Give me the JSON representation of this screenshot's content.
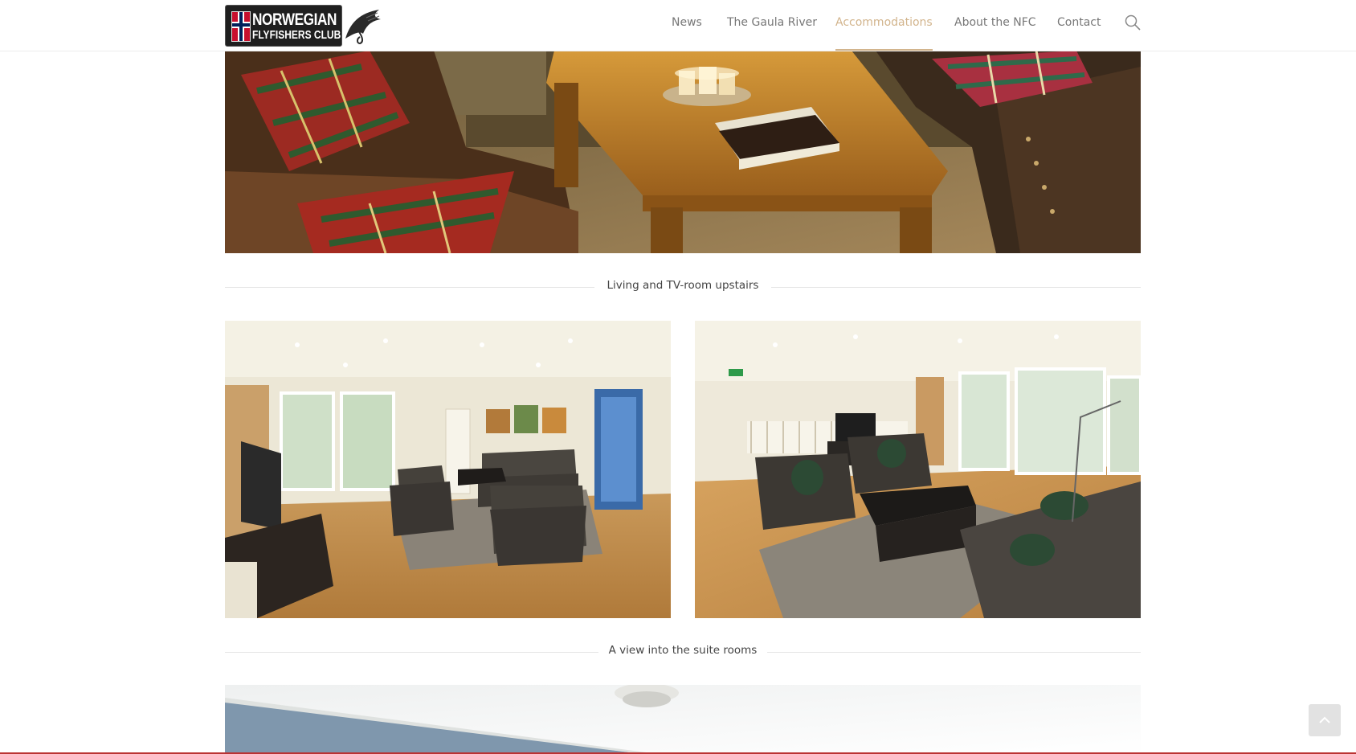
{
  "header": {
    "logo": {
      "line1": "NORWEGIAN",
      "line2": "FLYFISHERS CLUB"
    },
    "nav": [
      {
        "label": "News"
      },
      {
        "label": "The Gaula River"
      },
      {
        "label": "Accommodations",
        "active": true
      },
      {
        "label": "About the NFC"
      },
      {
        "label": "Contact"
      }
    ],
    "search_icon": "search-icon",
    "accent_color": "#d2b48c"
  },
  "gallery": {
    "captions": [
      "Living and TV-room upstairs",
      "A view into the suite rooms"
    ]
  },
  "scroll_top_icon": "chevron-up-icon"
}
